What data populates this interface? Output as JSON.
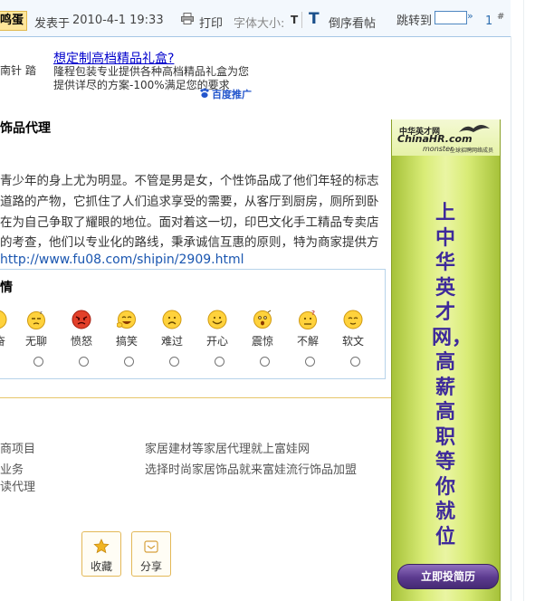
{
  "header": {
    "author_tag": "鸣蛋",
    "posted_label": "发表于",
    "posted_time": "2010-4-1 19:33",
    "print_label": "打印",
    "font_size_label": "字体大小:",
    "font_small": "T",
    "font_big": "T",
    "reverse_label": "倒序看帖",
    "jump_label": "跳转到",
    "jump_arrow": "»",
    "floor_number": "1",
    "floor_suffix": "#"
  },
  "ad": {
    "side_text": "南针 踏",
    "title": "想定制高档精品礼盒?",
    "line1": "隆程包装专业提供各种高档精品礼盒为您",
    "line2": "提供详尽的方案-100%满足您的要求",
    "provider": "百度推广"
  },
  "post": {
    "title": "饰品代理",
    "line1": "青少年的身上尤为明显。不管是男是女，个性饰品成了他们年轻的标志",
    "line2": "道路的产物，它抓住了人们追求享受的需要，从客厅到厨房，厕所到卧",
    "line3": "在为自己争取了耀眼的地位。面对着这一切，印巴文化手工精品专卖店",
    "line4_pre": "的考查，他们以",
    "line4_mark": "专业化",
    "line4_post": "的路线，秉承诚信互惠的原则，特为商家提供方",
    "link": "http://www.fu08.com/shipin/2909.html"
  },
  "mood": {
    "heading": "情",
    "items": [
      {
        "label": "奋",
        "icon": "excited-face-icon"
      },
      {
        "label": "无聊",
        "icon": "bored-face-icon"
      },
      {
        "label": "愤怒",
        "icon": "angry-face-icon"
      },
      {
        "label": "搞笑",
        "icon": "funny-face-icon"
      },
      {
        "label": "难过",
        "icon": "sad-face-icon"
      },
      {
        "label": "开心",
        "icon": "happy-face-icon"
      },
      {
        "label": "震惊",
        "icon": "shocked-face-icon"
      },
      {
        "label": "不解",
        "icon": "confused-face-icon"
      },
      {
        "label": "软文",
        "icon": "sly-face-icon"
      }
    ]
  },
  "related": {
    "left": [
      "商项目",
      "业务",
      "读代理"
    ],
    "right": [
      "家居建材等家居代理就上富娃网",
      "选择时尚家居饰品就来富娃流行饰品加盟"
    ]
  },
  "actions": {
    "favorite_label": "收藏",
    "share_label": "分享"
  },
  "banner": {
    "cn_brand": "中华英才网",
    "brand": "ChinaHR.com",
    "monster": "monster",
    "sub": "全球招聘网络成员",
    "slogan": "上中华英才网，高薪高职等你就位",
    "button": "立即投简历"
  },
  "colors": {
    "link_blue": "#1a56b0",
    "ad_title": "#0000cc",
    "banner_text": "#3e2a9a",
    "border_gold": "#e3b857"
  }
}
